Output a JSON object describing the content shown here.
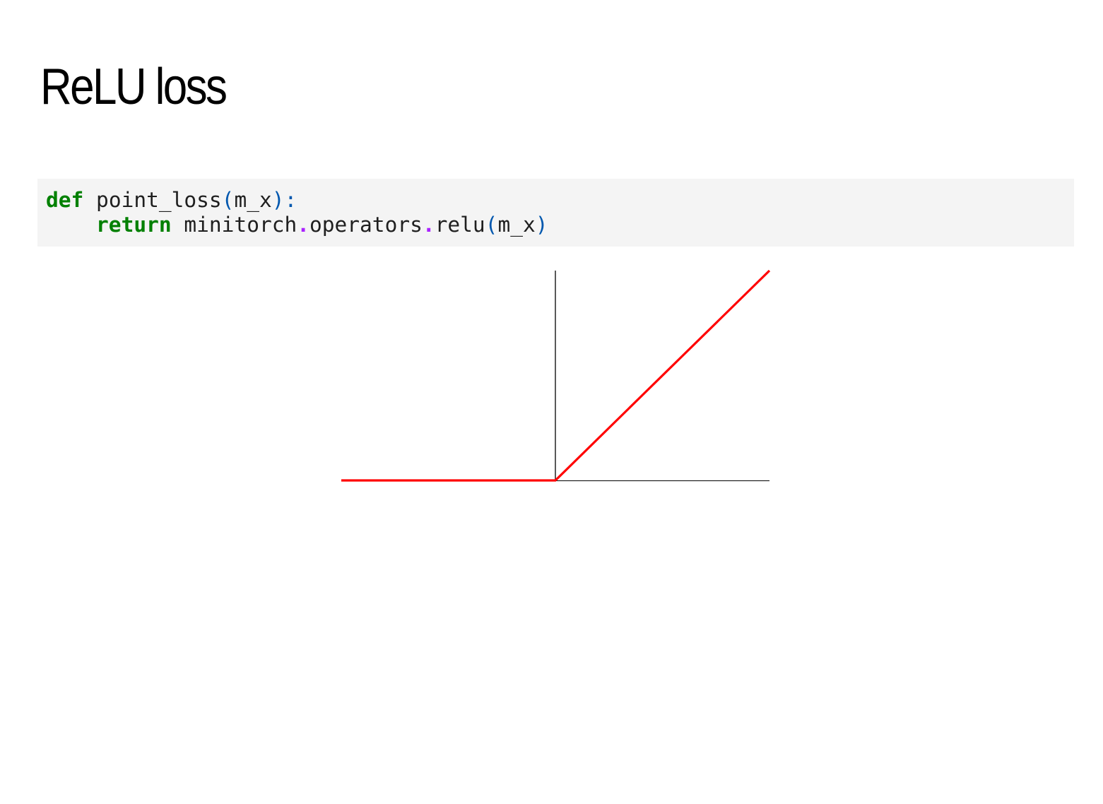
{
  "slide": {
    "title": "ReLU loss"
  },
  "code": {
    "line1": {
      "keyword": "def",
      "name": " point_loss",
      "open_paren": "(",
      "arg": "m_x",
      "close_paren": ")",
      "colon": ":"
    },
    "line2": {
      "indent": "    ",
      "keyword": "return",
      "module": " minitorch",
      "dot1": ".",
      "attr": "operators",
      "dot2": ".",
      "func": "relu",
      "open_paren": "(",
      "arg": "m_x",
      "close_paren": ")"
    }
  },
  "chart_data": {
    "type": "line",
    "title": "",
    "xlabel": "",
    "ylabel": "",
    "xlim": [
      -1,
      1
    ],
    "ylim": [
      0,
      1
    ],
    "grid": false,
    "legend": "none",
    "series": [
      {
        "color": "#ff0000",
        "x": [
          -1,
          0,
          1
        ],
        "y": [
          0,
          0,
          1
        ]
      }
    ]
  }
}
